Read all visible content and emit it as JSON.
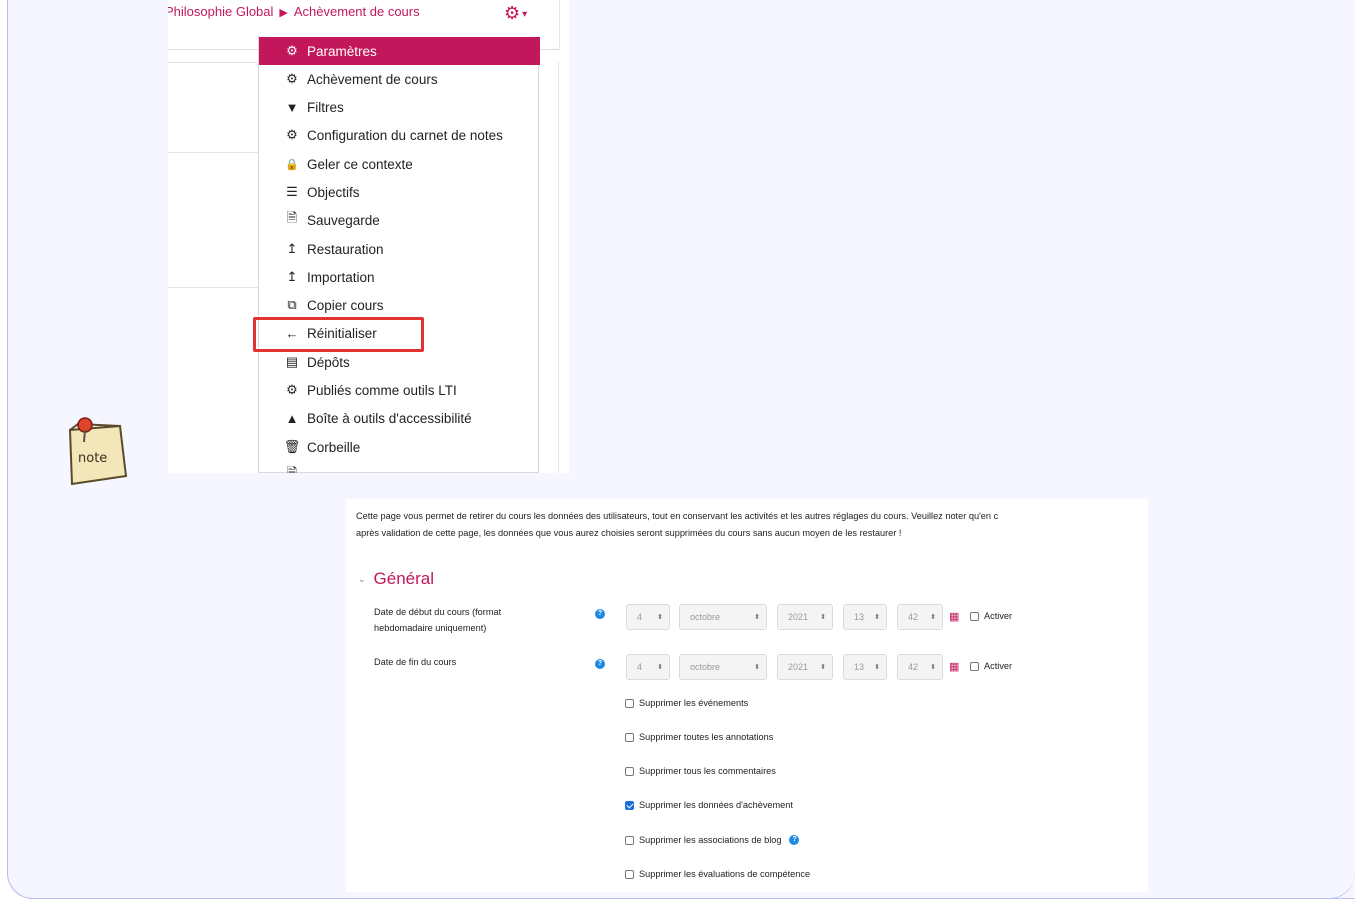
{
  "menu_screenshot": {
    "breadcrumb": {
      "course": "Philosophie Global",
      "current": "Achèvement de cours"
    },
    "gear_icon": "gear-icon",
    "items": [
      {
        "label": "Paramètres",
        "icon": "⚙",
        "active": true
      },
      {
        "label": "Achèvement de cours",
        "icon": "⚙"
      },
      {
        "label": "Filtres",
        "icon": "▼"
      },
      {
        "label": "Configuration du carnet de notes",
        "icon": "⚙"
      },
      {
        "label": "Geler ce contexte",
        "icon": "🔒"
      },
      {
        "label": "Objectifs",
        "icon": "☰"
      },
      {
        "label": "Sauvegarde",
        "icon": "🗎"
      },
      {
        "label": "Restauration",
        "icon": "↥"
      },
      {
        "label": "Importation",
        "icon": "↥"
      },
      {
        "label": "Copier cours",
        "icon": "⧉"
      },
      {
        "label": "Réinitialiser",
        "icon": "←",
        "highlighted": true
      },
      {
        "label": "Dépôts",
        "icon": "▤"
      },
      {
        "label": "Publiés comme outils LTI",
        "icon": "⚙"
      },
      {
        "label": "Boîte à outils d'accessibilité",
        "icon": "▲"
      },
      {
        "label": "Corbeille",
        "icon": "🗑"
      }
    ],
    "accent_color": "#c2185b",
    "highlight_color": "#e23232"
  },
  "form_screenshot": {
    "intro_line1": "Cette page vous permet de retirer du cours les données des utilisateurs, tout en conservant les activités et les autres réglages du cours. Veuillez noter qu'en c",
    "intro_line2": "après validation de cette page, les données que vous aurez choisies seront supprimées du cours sans aucun moyen de les restaurer !",
    "section_title": "Général",
    "start_date": {
      "label_line1": "Date de début du cours (format",
      "label_line2": "hebdomadaire uniquement)",
      "day": "4",
      "month": "octobre",
      "year": "2021",
      "hour": "13",
      "minute": "42",
      "enable_label": "Activer"
    },
    "end_date": {
      "label": "Date de fin du cours",
      "day": "4",
      "month": "octobre",
      "year": "2021",
      "hour": "13",
      "minute": "42",
      "enable_label": "Activer"
    },
    "checkboxes": [
      {
        "label": "Supprimer les événements",
        "checked": false
      },
      {
        "label": "Supprimer toutes les annotations",
        "checked": false
      },
      {
        "label": "Supprimer tous les commentaires",
        "checked": false
      },
      {
        "label": "Supprimer les données d'achèvement",
        "checked": true
      },
      {
        "label": "Supprimer les associations de blog",
        "checked": false,
        "help": true
      },
      {
        "label": "Supprimer les évaluations de compétence",
        "checked": false
      }
    ]
  },
  "note_icon": {
    "label": "note",
    "icon": "note-icon"
  }
}
